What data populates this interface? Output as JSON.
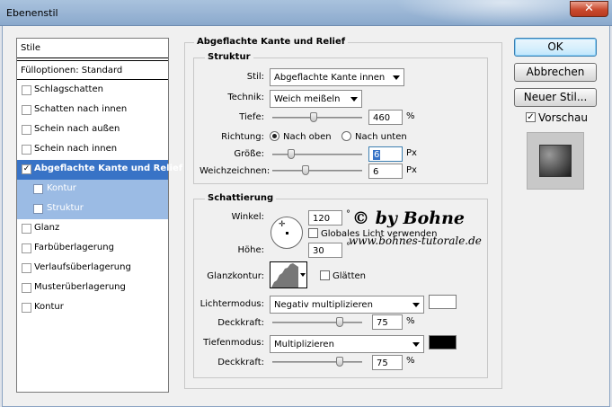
{
  "window": {
    "title": "Ebenenstil",
    "close_glyph": "✕"
  },
  "style_list": {
    "header": "Stile",
    "fill_options": "Fülloptionen: Standard",
    "items": [
      {
        "label": "Schlagschatten",
        "checked": false
      },
      {
        "label": "Schatten nach innen",
        "checked": false
      },
      {
        "label": "Schein nach außen",
        "checked": false
      },
      {
        "label": "Schein nach innen",
        "checked": false
      },
      {
        "label": "Abgeflachte Kante und Relief",
        "checked": true,
        "selected": true
      },
      {
        "label": "Kontur",
        "checked": false,
        "sub": true
      },
      {
        "label": "Struktur",
        "checked": false,
        "sub": true
      },
      {
        "label": "Glanz",
        "checked": false
      },
      {
        "label": "Farbüberlagerung",
        "checked": false
      },
      {
        "label": "Verlaufsüberlagerung",
        "checked": false
      },
      {
        "label": "Musterüberlagerung",
        "checked": false
      },
      {
        "label": "Kontur",
        "checked": false
      }
    ]
  },
  "main": {
    "section_title": "Abgeflachte Kante und Relief",
    "struktur": {
      "title": "Struktur",
      "stil_label": "Stil:",
      "stil_value": "Abgeflachte Kante innen",
      "technik_label": "Technik:",
      "technik_value": "Weich meißeln",
      "tiefe_label": "Tiefe:",
      "tiefe_value": "460",
      "tiefe_unit": "%",
      "richtung_label": "Richtung:",
      "richtung_up": "Nach oben",
      "richtung_down": "Nach unten",
      "groesse_label": "Größe:",
      "groesse_value": "6",
      "groesse_unit": "Px",
      "weich_label": "Weichzeichnen:",
      "weich_value": "6",
      "weich_unit": "Px"
    },
    "schattierung": {
      "title": "Schattierung",
      "winkel_label": "Winkel:",
      "winkel_value": "120",
      "winkel_unit": "°",
      "global_light_label": "Globales Licht verwenden",
      "hoehe_label": "Höhe:",
      "hoehe_value": "30",
      "hoehe_unit": "°",
      "glanzkontur_label": "Glanzkontur:",
      "glaetten_label": "Glätten",
      "lichtermodus_label": "Lichtermodus:",
      "lichtermodus_value": "Negativ multiplizieren",
      "lichter_color": "#ffffff",
      "deckkraft1_label": "Deckkraft:",
      "deckkraft1_value": "75",
      "deckkraft1_unit": "%",
      "tiefenmodus_label": "Tiefenmodus:",
      "tiefenmodus_value": "Multiplizieren",
      "tiefen_color": "#000000",
      "deckkraft2_label": "Deckkraft:",
      "deckkraft2_value": "75",
      "deckkraft2_unit": "%"
    }
  },
  "buttons": {
    "ok": "OK",
    "cancel": "Abbrechen",
    "new_style": "Neuer Stil...",
    "preview": "Vorschau"
  },
  "watermark": {
    "line1": "© by Bohne",
    "line2": "www.bohnes-tutorale.de"
  }
}
